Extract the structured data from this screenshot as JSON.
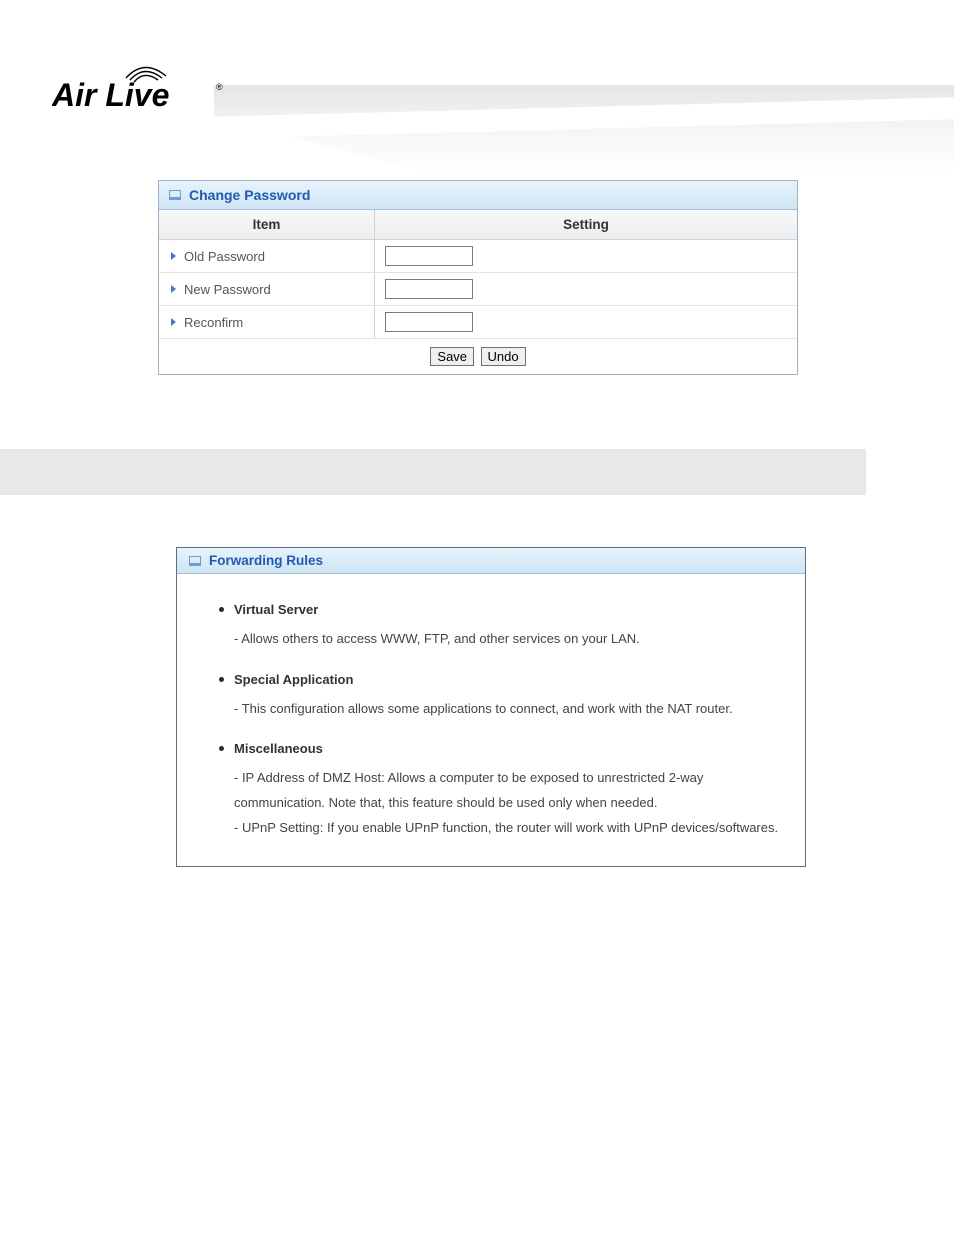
{
  "brand": {
    "name": "Air Live"
  },
  "change_password": {
    "title": "Change Password",
    "head_item": "Item",
    "head_setting": "Setting",
    "rows": {
      "r0": {
        "label": "Old Password",
        "value": ""
      },
      "r1": {
        "label": "New Password",
        "value": ""
      },
      "r2": {
        "label": "Reconfirm",
        "value": ""
      }
    },
    "save_label": "Save",
    "undo_label": "Undo"
  },
  "forwarding_rules": {
    "title": "Forwarding Rules",
    "items": {
      "i0": {
        "title": "Virtual Server",
        "desc": "- Allows others to access WWW, FTP, and other services on your LAN."
      },
      "i1": {
        "title": "Special Application",
        "desc": "- This configuration allows some applications to connect, and work with the NAT router."
      },
      "i2": {
        "title": "Miscellaneous",
        "desc": "- IP Address of DMZ Host: Allows a computer to be exposed to unrestricted 2-way communication. Note that, this feature should be used only when needed.\n- UPnP Setting: If you enable UPnP function, the router will work with UPnP devices/softwares."
      }
    }
  }
}
